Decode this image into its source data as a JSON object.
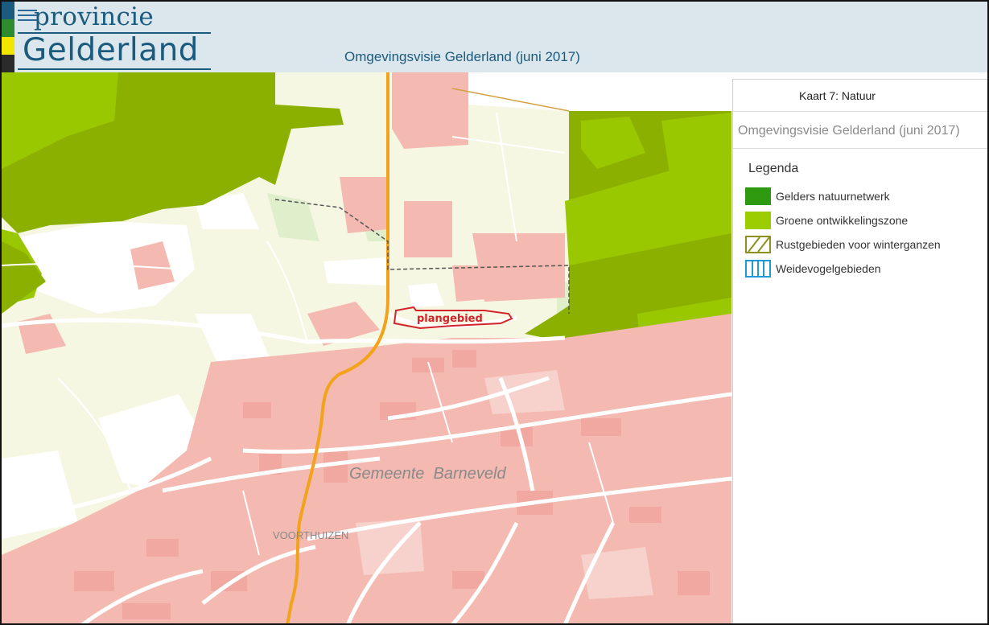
{
  "header": {
    "logo_top": "provincie",
    "logo_bottom": "Gelderland",
    "app_title": "Omgevingsvisie Gelderland (juni 2017)",
    "menu_icon": "hamburger-menu-icon",
    "stripe_colors": [
      "#1b5b7e",
      "#2e8b2e",
      "#f2e500",
      "#2b2b2b"
    ]
  },
  "map": {
    "labels": {
      "municipality": "Gemeente  Barneveld",
      "town": "VOORTHUIZEN",
      "plan_area": "plangebied"
    },
    "colors": {
      "background": "#f6f7e2",
      "urban": "#f4b9b0",
      "urban_dark": "#f0a8a0",
      "nature_network": "#8cb000",
      "green_zone": "#9ac800",
      "road": "#ffffff",
      "main_road": "#f2a31b",
      "plan_outline": "#d2232a"
    }
  },
  "panel": {
    "map_name": "Kaart 7: Natuur",
    "subtitle": "Omgevingsvisie Gelderland (juni 2017)",
    "legend_title": "Legenda",
    "legend": [
      {
        "label": "Gelders natuurnetwerk",
        "icon": "solid-swatch",
        "color": "#2f9a10"
      },
      {
        "label": "Groene ontwikkelingszone",
        "icon": "solid-swatch",
        "color": "#9ccd00"
      },
      {
        "label": "Rustgebieden voor winterganzen",
        "icon": "hatched-swatch",
        "color": "#8f8f1e"
      },
      {
        "label": "Weidevogelgebieden",
        "icon": "vertical-lines-swatch",
        "color": "#1e9ad6"
      }
    ]
  }
}
